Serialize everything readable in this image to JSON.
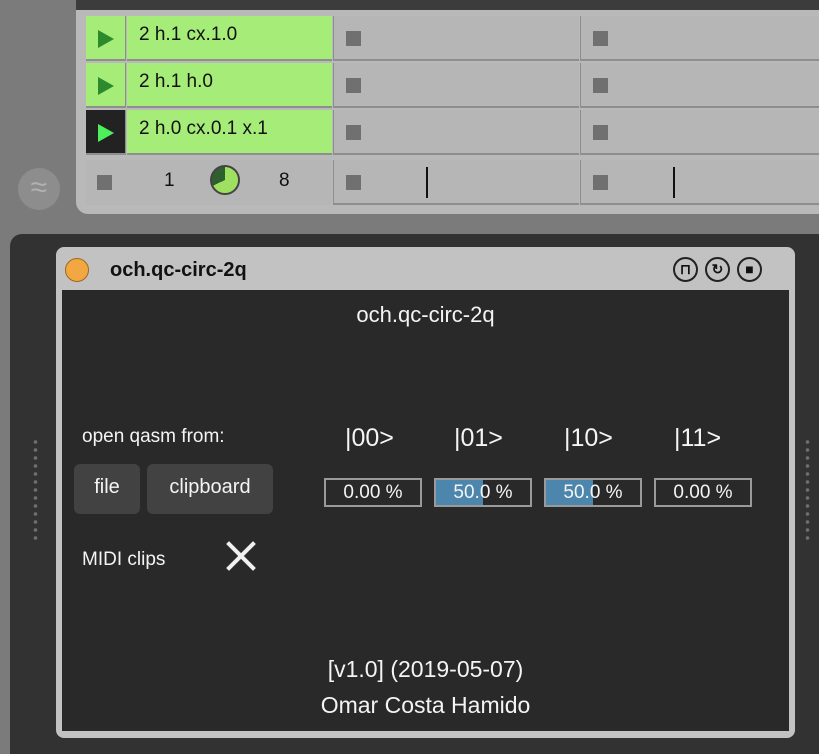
{
  "session": {
    "clips": [
      {
        "name": "2 h.1 cx.1.0",
        "playing": false
      },
      {
        "name": "2 h.1 h.0",
        "playing": false
      },
      {
        "name": "2 h.0 cx.0.1 x.1",
        "playing": true
      }
    ],
    "status": {
      "left_number": "1",
      "right_number": "8",
      "progress": 0.68
    }
  },
  "device": {
    "header_title": "och.qc-circ-2q",
    "icons": [
      "pin-icon",
      "refresh-icon",
      "save-icon"
    ],
    "panel_title": "och.qc-circ-2q",
    "open_label": "open qasm from:",
    "file_button": "file",
    "clipboard_button": "clipboard",
    "midi_label": "MIDI clips",
    "states": [
      {
        "label": "|00>",
        "value": "0.00 %",
        "fraction": 0.0
      },
      {
        "label": "|01>",
        "value": "50.0 %",
        "fraction": 0.5
      },
      {
        "label": "|10>",
        "value": "50.0 %",
        "fraction": 0.5
      },
      {
        "label": "|11>",
        "value": "0.00 %",
        "fraction": 0.0
      }
    ],
    "version": "[v1.0] (2019-05-07)",
    "author": "Omar Costa Hamido"
  },
  "colors": {
    "clip_green": "#a6ec78",
    "power_orange": "#f2a743",
    "bar_blue": "#4d86ad"
  }
}
